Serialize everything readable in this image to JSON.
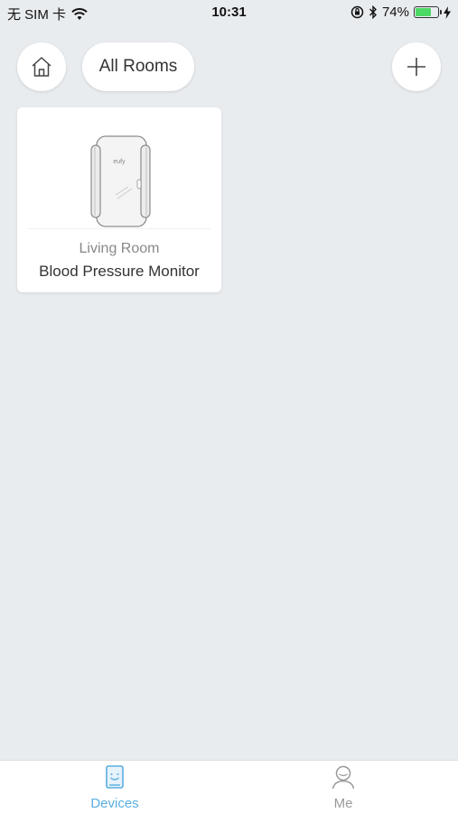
{
  "status_bar": {
    "carrier": "无 SIM 卡",
    "time": "10:31",
    "battery_percent": "74%",
    "battery_level": 0.74
  },
  "header": {
    "rooms_label": "All Rooms"
  },
  "devices": [
    {
      "room": "Living Room",
      "name": "Blood Pressure Monitor",
      "brand": "eufy"
    }
  ],
  "tab_bar": {
    "tabs": [
      {
        "label": "Devices",
        "active": true,
        "color": "#5aaee0"
      },
      {
        "label": "Me",
        "active": false,
        "color": "#9a9a9a"
      }
    ]
  },
  "colors": {
    "background": "#e9ecef",
    "accent": "#5aaee0",
    "battery": "#4cd964"
  }
}
